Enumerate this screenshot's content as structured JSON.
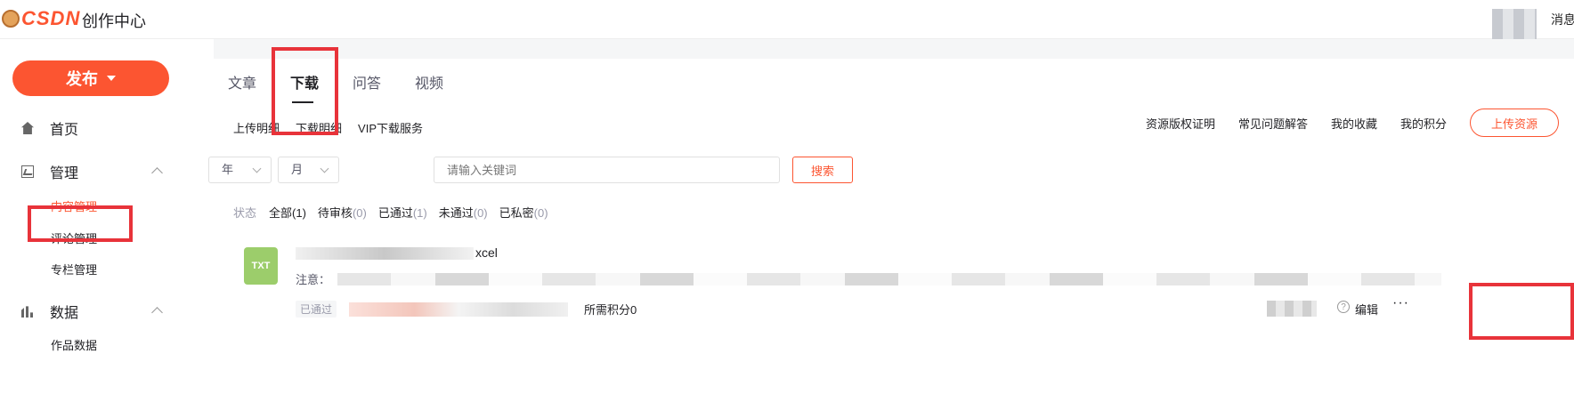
{
  "header": {
    "logo_text": "CSDN",
    "app_title": "创作中心",
    "messages_label": "消息"
  },
  "sidebar": {
    "publish_label": "发布",
    "items": [
      {
        "label": "首页",
        "icon": "home-icon"
      },
      {
        "label": "管理",
        "icon": "chart-icon",
        "expanded": true
      },
      {
        "label": "数据",
        "icon": "bar-chart-icon",
        "expanded": true
      }
    ],
    "manage_sub": [
      "内容管理",
      "评论管理",
      "专栏管理"
    ],
    "data_sub": [
      "作品数据"
    ]
  },
  "tabs": [
    "文章",
    "下载",
    "问答",
    "视频"
  ],
  "active_tab": "下载",
  "subtabs": [
    "上传明细",
    "下载明细",
    "VIP下载服务"
  ],
  "links": [
    "资源版权证明",
    "常见问题解答",
    "我的收藏",
    "我的积分"
  ],
  "upload_label": "上传资源",
  "filters": {
    "year": "年",
    "month": "月",
    "search_placeholder": "请输入关键词",
    "search_label": "搜索"
  },
  "status": {
    "label": "状态",
    "items": [
      {
        "name": "全部",
        "count": "(1)"
      },
      {
        "name": "待审核",
        "count": "(0)"
      },
      {
        "name": "已通过",
        "count": "(1)"
      },
      {
        "name": "未通过",
        "count": "(0)"
      },
      {
        "name": "已私密",
        "count": "(0)"
      }
    ]
  },
  "item": {
    "file_type": "TXT",
    "title_suffix": "xcel",
    "note_label": "注意：",
    "badge": "已通过",
    "points": "所需积分0",
    "edit_label": "编辑",
    "more_label": "···",
    "help": "?"
  },
  "colors": {
    "brand": "#fc5531",
    "highlight": "#e8333a",
    "file_icon": "#9ccd6b"
  }
}
